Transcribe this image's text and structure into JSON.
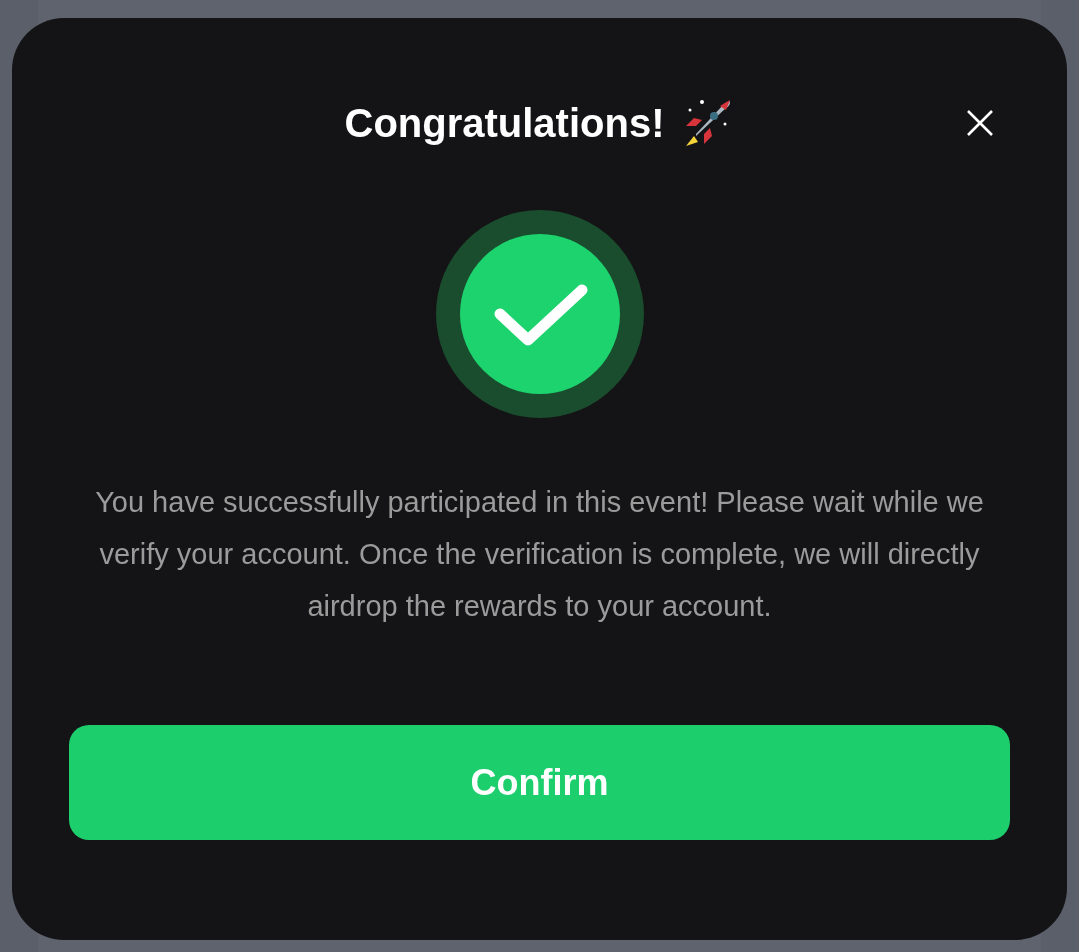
{
  "dialog": {
    "title": "Congratulations!",
    "message": "You have successfully participated in this event! Please wait while we verify your account. Once the verification is complete, we will directly airdrop the rewards to your account.",
    "confirm_button": "Confirm"
  }
}
